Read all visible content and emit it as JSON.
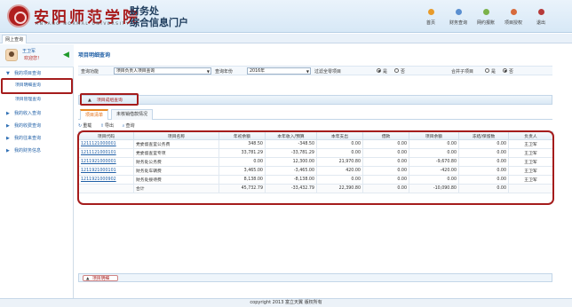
{
  "header": {
    "school_cn": "安阳师范学院",
    "school_en": "ANYANG NORMAL UNIVERSITY",
    "portal_line1": "财务处",
    "portal_line2": "综合信息门户",
    "nav": [
      {
        "label": "首页",
        "color": "#e89b2a"
      },
      {
        "label": "财务查询",
        "color": "#5a8fd0"
      },
      {
        "label": "网约报账",
        "color": "#7bb24a"
      },
      {
        "label": "项目授权",
        "color": "#d76a3c"
      },
      {
        "label": "退出",
        "color": "#b63a3a"
      }
    ]
  },
  "top_tab": "网上查询",
  "sidebar": {
    "user_name": "王卫军",
    "welcome": "欢迎您！",
    "items": [
      {
        "label": "我的项目查询"
      },
      {
        "label": "项目明细查询"
      },
      {
        "label": "项目管理查询"
      },
      {
        "label": "我的收入查询"
      },
      {
        "label": "我的收费查询"
      },
      {
        "label": "我的往来查询"
      },
      {
        "label": "我的财务信息"
      }
    ]
  },
  "main": {
    "section_title": "项目明细查询",
    "filter": {
      "func_label": "查询功能",
      "func_value": "项目负责人项目查询",
      "year_label": "查询年份",
      "year_value": "2016年",
      "zero_label": "过滤全零项目",
      "yes": "是",
      "no": "否",
      "merge_label": "合并子项目"
    },
    "collapse_label": "项目成组查询",
    "tabs": [
      {
        "label": "项目清单"
      },
      {
        "label": "未核销借款情况"
      }
    ],
    "tools": {
      "refresh": "重载",
      "export": "导出",
      "query": "查询"
    },
    "columns": [
      "项目代码",
      "项目名称",
      "年初余额",
      "本年收入/预算",
      "本年支出",
      "借款",
      "项目余额",
      "冻结/保留数",
      "负责人"
    ],
    "rows": [
      [
        "1211121000001",
        "党委督查室公务费",
        "348.50",
        "-348.50",
        "0.00",
        "0.00",
        "0.00",
        "0.00",
        "王卫军"
      ],
      [
        "1211121000101",
        "党委督查室专项",
        "33,781.29",
        "-33,781.29",
        "0.00",
        "0.00",
        "0.00",
        "0.00",
        "王卫军"
      ],
      [
        "1211921000001",
        "财务处公务费",
        "0.00",
        "12,300.00",
        "21,970.80",
        "0.00",
        "-9,670.80",
        "0.00",
        "王卫军"
      ],
      [
        "1211921000101",
        "财务处车辆费",
        "3,465.00",
        "-3,465.00",
        "420.00",
        "0.00",
        "-420.00",
        "0.00",
        "王卫军"
      ],
      [
        "1211921000902",
        "财务处接待费",
        "8,138.00",
        "-8,138.00",
        "0.00",
        "0.00",
        "0.00",
        "0.00",
        "王卫军"
      ]
    ],
    "total": [
      "",
      "合计",
      "45,732.79",
      "-33,432.79",
      "22,390.80",
      "0.00",
      "-10,090.80",
      "0.00",
      ""
    ],
    "bottom_label": "项目明细"
  },
  "footer": "copyright 2013 富立天翼 版权所有"
}
